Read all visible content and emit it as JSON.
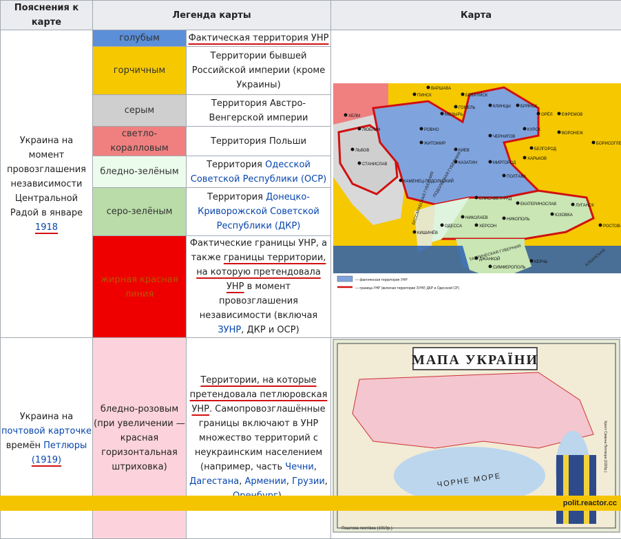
{
  "headers": {
    "explanations": "Пояснения к карте",
    "legend": "Легенда карты",
    "map": "Карта"
  },
  "section1": {
    "explanation_text": "Украина на момент провозглашения независимости Центральной Радой в январе",
    "explanation_year": "1918",
    "rows": [
      {
        "color": "голубым",
        "description": "Фактическая территория УНР"
      },
      {
        "color": "горчичным",
        "description": "Территории бывшей Российской империи (кроме Украины)"
      },
      {
        "color": "серым",
        "description": "Территория Австро-Венгерской империи"
      },
      {
        "color": "светло-коралловым",
        "description": "Территория Польши"
      },
      {
        "color": "бледно-зелёным",
        "description_prefix": "Территория",
        "description_link": "Одесской Советской Республики (ОСР)"
      },
      {
        "color": "серо-зелёным",
        "description_prefix": "Территория",
        "description_link": "Донецко-Криворожской Советской Республики (ДКР)"
      },
      {
        "color": "жирная красная линия",
        "desc_part1": "Фактические границы УНР, а также",
        "desc_part2": "границы территории, на которую претендовала УНР",
        "desc_part3": "в момент провозглашения независимости (включая",
        "desc_link": "ЗУНР",
        "desc_part4": ", ДКР и ОСР)"
      }
    ],
    "map_labels": {
      "cities": [
        "Варшава",
        "Пинск",
        "Бобруйск",
        "Гомель",
        "Клинцы",
        "Брянск",
        "Орёл",
        "Ефремов",
        "Курск",
        "Воронеж",
        "Белгород",
        "Харьков",
        "Борисоглебск",
        "Хелм",
        "Люблин",
        "Ровно",
        "Житомир",
        "Мозырь",
        "Чернигов",
        "Львов",
        "Станислав",
        "Каменец-Подольский",
        "Киев",
        "Казатин",
        "Миргород",
        "Полтава",
        "Елисаветград",
        "Екатеринослав",
        "Луганск",
        "Николаев",
        "Херсон",
        "Никополь",
        "Юзовка",
        "Одесса",
        "Кишинёв",
        "Джанкой",
        "Симферополь",
        "Керчь",
        "Ростов-на-Дону"
      ],
      "regions": [
        "Подольская губерния",
        "Бессарабская губерния",
        "Таврическая губерния",
        "Кубанская"
      ],
      "legend_1": "— фактическая территория УНР",
      "legend_2": "— граница УНР (включая территории ЗУНР, ДКР и Одесской СР)"
    }
  },
  "section2": {
    "explanation_prefix": "Украина на",
    "explanation_link": "почтовой карточке",
    "explanation_mid": "времён",
    "explanation_link2": "Петлюры",
    "explanation_year": "1919",
    "color": "бледно-розовым (при увеличении — красная горизонтальная штриховка)",
    "desc_part1": "Территории, на которые претендовала петлюровская УНР",
    "desc_part2": ". Самопровозглашённые границы включают в УНР множество территорий с неукраинским населением (например, часть",
    "links": [
      "Чечни",
      "Дагестана",
      "Армении",
      "Грузии",
      "Оренбург"
    ],
    "map_title": "МАПА УКРАЇНИ",
    "map_sea": "ЧОРНЕ МОРЕ",
    "map_caption": "Поштова листівка (1919р.)",
    "map_side": "Хрест Симона Петлюри (1920р.)"
  },
  "watermark": "polit.reactor.cc"
}
